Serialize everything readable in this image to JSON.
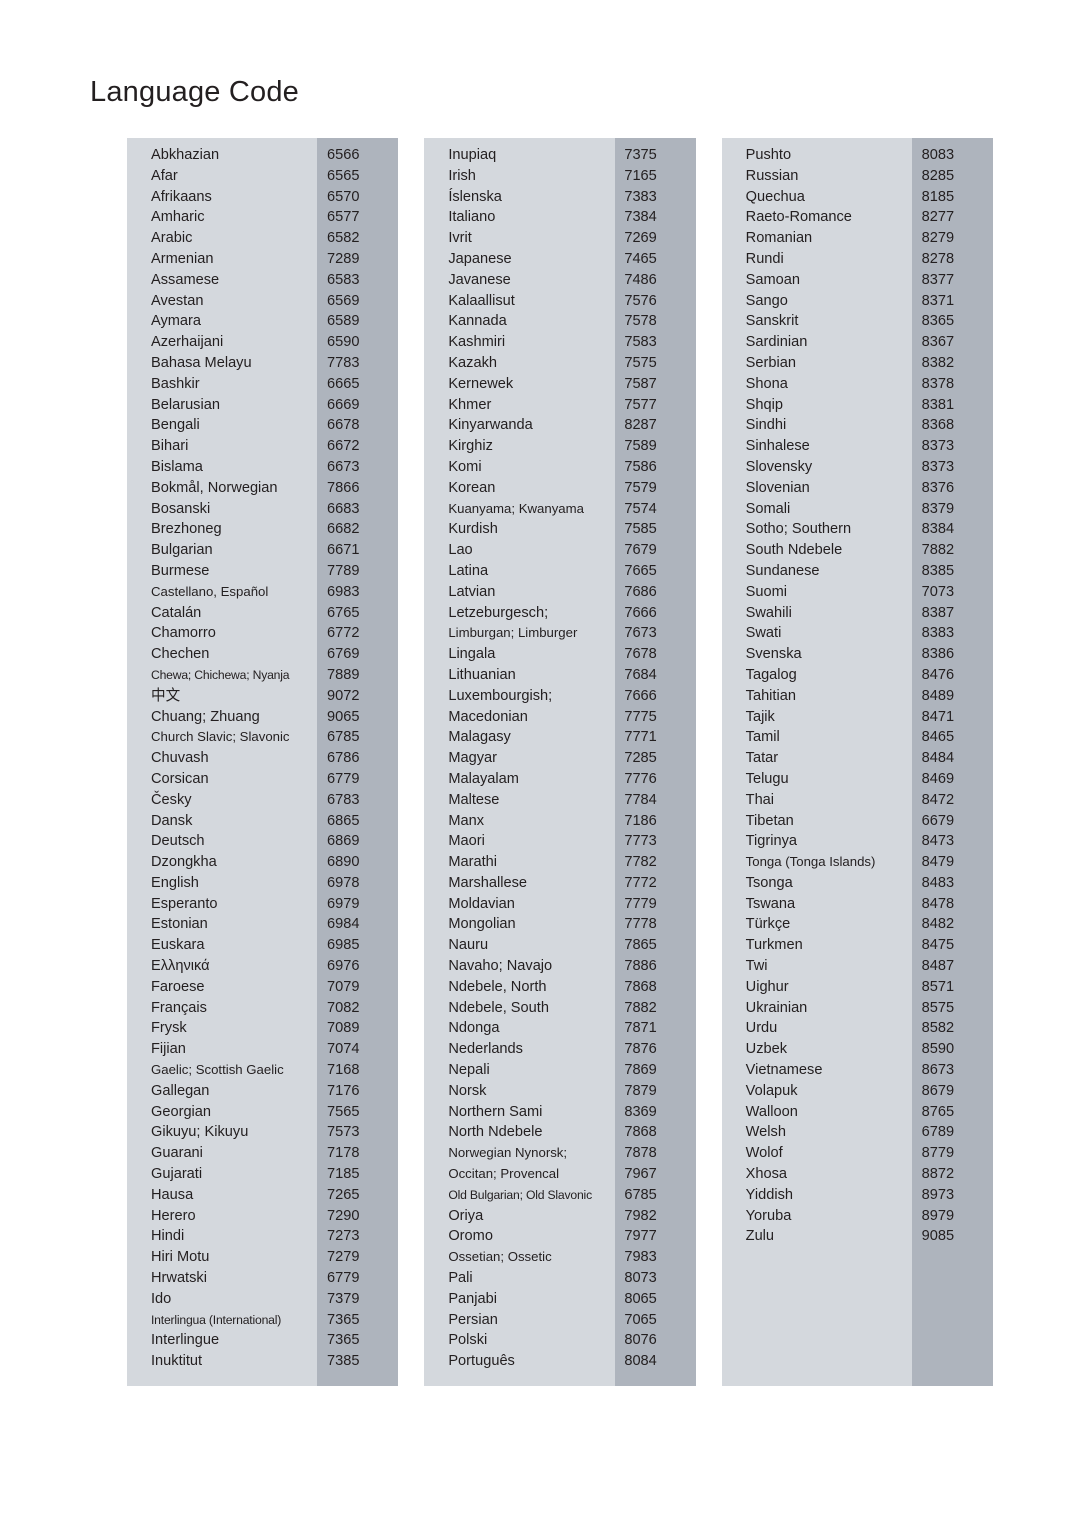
{
  "page": {
    "title": "Language Code"
  },
  "columns": [
    {
      "id": "column-1",
      "rows": [
        {
          "name": "Abkhazian",
          "code": "6566"
        },
        {
          "name": "Afar",
          "code": "6565"
        },
        {
          "name": "Afrikaans",
          "code": "6570"
        },
        {
          "name": "Amharic",
          "code": "6577"
        },
        {
          "name": "Arabic",
          "code": "6582"
        },
        {
          "name": "Armenian",
          "code": "7289"
        },
        {
          "name": "Assamese",
          "code": "6583"
        },
        {
          "name": "Avestan",
          "code": "6569"
        },
        {
          "name": "Aymara",
          "code": "6589"
        },
        {
          "name": "Azerhaijani",
          "code": "6590"
        },
        {
          "name": "Bahasa Melayu",
          "code": "7783"
        },
        {
          "name": "Bashkir",
          "code": "6665"
        },
        {
          "name": "Belarusian",
          "code": "6669"
        },
        {
          "name": "Bengali",
          "code": "6678"
        },
        {
          "name": "Bihari",
          "code": "6672"
        },
        {
          "name": "Bislama",
          "code": "6673"
        },
        {
          "name": "Bokmål, Norwegian",
          "code": "7866"
        },
        {
          "name": "Bosanski",
          "code": "6683"
        },
        {
          "name": "Brezhoneg",
          "code": "6682"
        },
        {
          "name": "Bulgarian",
          "code": "6671"
        },
        {
          "name": "Burmese",
          "code": "7789"
        },
        {
          "name": "Castellano, Español",
          "code": "6983",
          "size": "tight"
        },
        {
          "name": "Catalán",
          "code": "6765"
        },
        {
          "name": "Chamorro",
          "code": "6772"
        },
        {
          "name": "Chechen",
          "code": "6769"
        },
        {
          "name": "Chewa; Chichewa; Nyanja",
          "code": "7889",
          "size": "vtight"
        },
        {
          "name": "中文",
          "code": "9072",
          "cjk": true
        },
        {
          "name": "Chuang; Zhuang",
          "code": "9065"
        },
        {
          "name": "Church Slavic; Slavonic",
          "code": "6785",
          "size": "tight"
        },
        {
          "name": "Chuvash",
          "code": "6786"
        },
        {
          "name": "Corsican",
          "code": "6779"
        },
        {
          "name": "Česky",
          "code": "6783"
        },
        {
          "name": "Dansk",
          "code": "6865"
        },
        {
          "name": "Deutsch",
          "code": "6869"
        },
        {
          "name": "Dzongkha",
          "code": "6890"
        },
        {
          "name": "English",
          "code": "6978"
        },
        {
          "name": "Esperanto",
          "code": "6979"
        },
        {
          "name": "Estonian",
          "code": "6984"
        },
        {
          "name": "Euskara",
          "code": "6985"
        },
        {
          "name": "Ελληνικά",
          "code": "6976"
        },
        {
          "name": "Faroese",
          "code": "7079"
        },
        {
          "name": "Français",
          "code": "7082"
        },
        {
          "name": "Frysk",
          "code": "7089"
        },
        {
          "name": "Fijian",
          "code": "7074"
        },
        {
          "name": "Gaelic; Scottish Gaelic",
          "code": "7168",
          "size": "tight"
        },
        {
          "name": "Gallegan",
          "code": "7176"
        },
        {
          "name": "Georgian",
          "code": "7565"
        },
        {
          "name": "Gikuyu; Kikuyu",
          "code": "7573"
        },
        {
          "name": "Guarani",
          "code": "7178"
        },
        {
          "name": "Gujarati",
          "code": "7185"
        },
        {
          "name": "Hausa",
          "code": "7265"
        },
        {
          "name": "Herero",
          "code": "7290"
        },
        {
          "name": "Hindi",
          "code": "7273"
        },
        {
          "name": "Hiri Motu",
          "code": "7279"
        },
        {
          "name": "Hrwatski",
          "code": "6779"
        },
        {
          "name": "Ido",
          "code": "7379"
        },
        {
          "name": "Interlingua (International)",
          "code": "7365",
          "size": "vtight"
        },
        {
          "name": "Interlingue",
          "code": "7365"
        },
        {
          "name": "Inuktitut",
          "code": "7385"
        }
      ]
    },
    {
      "id": "column-2",
      "rows": [
        {
          "name": "Inupiaq",
          "code": "7375"
        },
        {
          "name": "Irish",
          "code": "7165"
        },
        {
          "name": "Íslenska",
          "code": "7383"
        },
        {
          "name": "Italiano",
          "code": "7384"
        },
        {
          "name": "Ivrit",
          "code": "7269"
        },
        {
          "name": "Japanese",
          "code": "7465"
        },
        {
          "name": "Javanese",
          "code": "7486"
        },
        {
          "name": "Kalaallisut",
          "code": "7576"
        },
        {
          "name": "Kannada",
          "code": "7578"
        },
        {
          "name": "Kashmiri",
          "code": "7583"
        },
        {
          "name": "Kazakh",
          "code": "7575"
        },
        {
          "name": "Kernewek",
          "code": "7587"
        },
        {
          "name": "Khmer",
          "code": "7577"
        },
        {
          "name": "Kinyarwanda",
          "code": "8287"
        },
        {
          "name": "Kirghiz",
          "code": "7589"
        },
        {
          "name": "Komi",
          "code": "7586"
        },
        {
          "name": "Korean",
          "code": "7579"
        },
        {
          "name": "Kuanyama; Kwanyama",
          "code": "7574",
          "size": "tight"
        },
        {
          "name": "Kurdish",
          "code": "7585"
        },
        {
          "name": "Lao",
          "code": "7679"
        },
        {
          "name": "Latina",
          "code": "7665"
        },
        {
          "name": "Latvian",
          "code": "7686"
        },
        {
          "name": "Letzeburgesch;",
          "code": "7666"
        },
        {
          "name": "Limburgan; Limburger",
          "code": "7673",
          "size": "tight"
        },
        {
          "name": "Lingala",
          "code": "7678"
        },
        {
          "name": "Lithuanian",
          "code": "7684"
        },
        {
          "name": "Luxembourgish;",
          "code": "7666"
        },
        {
          "name": "Macedonian",
          "code": "7775"
        },
        {
          "name": "Malagasy",
          "code": "7771"
        },
        {
          "name": "Magyar",
          "code": "7285"
        },
        {
          "name": "Malayalam",
          "code": "7776"
        },
        {
          "name": "Maltese",
          "code": "7784"
        },
        {
          "name": "Manx",
          "code": "7186"
        },
        {
          "name": "Maori",
          "code": "7773"
        },
        {
          "name": "Marathi",
          "code": "7782"
        },
        {
          "name": "Marshallese",
          "code": "7772"
        },
        {
          "name": "Moldavian",
          "code": "7779"
        },
        {
          "name": "Mongolian",
          "code": "7778"
        },
        {
          "name": "Nauru",
          "code": "7865"
        },
        {
          "name": "Navaho; Navajo",
          "code": "7886"
        },
        {
          "name": "Ndebele, North",
          "code": "7868"
        },
        {
          "name": "Ndebele, South",
          "code": "7882"
        },
        {
          "name": "Ndonga",
          "code": "7871"
        },
        {
          "name": "Nederlands",
          "code": "7876"
        },
        {
          "name": "Nepali",
          "code": "7869"
        },
        {
          "name": "Norsk",
          "code": "7879"
        },
        {
          "name": "Northern Sami",
          "code": "8369"
        },
        {
          "name": "North Ndebele",
          "code": "7868"
        },
        {
          "name": "Norwegian Nynorsk;",
          "code": "7878",
          "size": "tight"
        },
        {
          "name": "Occitan; Provencal",
          "code": "7967",
          "size": "tight"
        },
        {
          "name": "Old Bulgarian; Old Slavonic",
          "code": "6785",
          "size": "vtight"
        },
        {
          "name": "Oriya",
          "code": "7982"
        },
        {
          "name": "Oromo",
          "code": "7977"
        },
        {
          "name": "Ossetian; Ossetic",
          "code": "7983",
          "size": "tight"
        },
        {
          "name": "Pali",
          "code": "8073"
        },
        {
          "name": "Panjabi",
          "code": "8065"
        },
        {
          "name": "Persian",
          "code": "7065"
        },
        {
          "name": "Polski",
          "code": "8076"
        },
        {
          "name": "Português",
          "code": "8084"
        }
      ]
    },
    {
      "id": "column-3",
      "rows": [
        {
          "name": "Pushto",
          "code": "8083"
        },
        {
          "name": "Russian",
          "code": "8285"
        },
        {
          "name": "Quechua",
          "code": "8185"
        },
        {
          "name": "Raeto-Romance",
          "code": "8277"
        },
        {
          "name": "Romanian",
          "code": "8279"
        },
        {
          "name": "Rundi",
          "code": "8278"
        },
        {
          "name": "Samoan",
          "code": "8377"
        },
        {
          "name": "Sango",
          "code": "8371"
        },
        {
          "name": "Sanskrit",
          "code": "8365"
        },
        {
          "name": "Sardinian",
          "code": "8367"
        },
        {
          "name": "Serbian",
          "code": "8382"
        },
        {
          "name": "Shona",
          "code": "8378"
        },
        {
          "name": "Shqip",
          "code": "8381"
        },
        {
          "name": "Sindhi",
          "code": "8368"
        },
        {
          "name": "Sinhalese",
          "code": "8373"
        },
        {
          "name": "Slovensky",
          "code": "8373"
        },
        {
          "name": "Slovenian",
          "code": "8376"
        },
        {
          "name": "Somali",
          "code": "8379"
        },
        {
          "name": "Sotho; Southern",
          "code": "8384"
        },
        {
          "name": "South Ndebele",
          "code": "7882"
        },
        {
          "name": "Sundanese",
          "code": "8385"
        },
        {
          "name": "Suomi",
          "code": "7073"
        },
        {
          "name": "Swahili",
          "code": "8387"
        },
        {
          "name": "Swati",
          "code": "8383"
        },
        {
          "name": "Svenska",
          "code": "8386"
        },
        {
          "name": "Tagalog",
          "code": "8476"
        },
        {
          "name": "Tahitian",
          "code": "8489"
        },
        {
          "name": "Tajik",
          "code": "8471"
        },
        {
          "name": "Tamil",
          "code": "8465"
        },
        {
          "name": "Tatar",
          "code": "8484"
        },
        {
          "name": "Telugu",
          "code": "8469"
        },
        {
          "name": "Thai",
          "code": "8472"
        },
        {
          "name": "Tibetan",
          "code": "6679"
        },
        {
          "name": "Tigrinya",
          "code": "8473"
        },
        {
          "name": "Tonga (Tonga Islands)",
          "code": "8479",
          "size": "tight"
        },
        {
          "name": "Tsonga",
          "code": "8483"
        },
        {
          "name": "Tswana",
          "code": "8478"
        },
        {
          "name": "Türkçe",
          "code": "8482"
        },
        {
          "name": "Turkmen",
          "code": "8475"
        },
        {
          "name": "Twi",
          "code": "8487"
        },
        {
          "name": "Uighur",
          "code": "8571"
        },
        {
          "name": "Ukrainian",
          "code": "8575"
        },
        {
          "name": "Urdu",
          "code": "8582"
        },
        {
          "name": "Uzbek",
          "code": "8590"
        },
        {
          "name": "Vietnamese",
          "code": "8673"
        },
        {
          "name": "Volapuk",
          "code": "8679"
        },
        {
          "name": "Walloon",
          "code": "8765"
        },
        {
          "name": "Welsh",
          "code": "6789"
        },
        {
          "name": "Wolof",
          "code": "8779"
        },
        {
          "name": "Xhosa",
          "code": "8872"
        },
        {
          "name": "Yiddish",
          "code": "8973"
        },
        {
          "name": "Yoruba",
          "code": "8979"
        },
        {
          "name": "Zulu",
          "code": "9085"
        }
      ]
    }
  ],
  "colors": {
    "panel_background": "#d4d8dd",
    "code_band": "#aeb4bd",
    "text": "#231f20",
    "page_background": "#ffffff"
  }
}
